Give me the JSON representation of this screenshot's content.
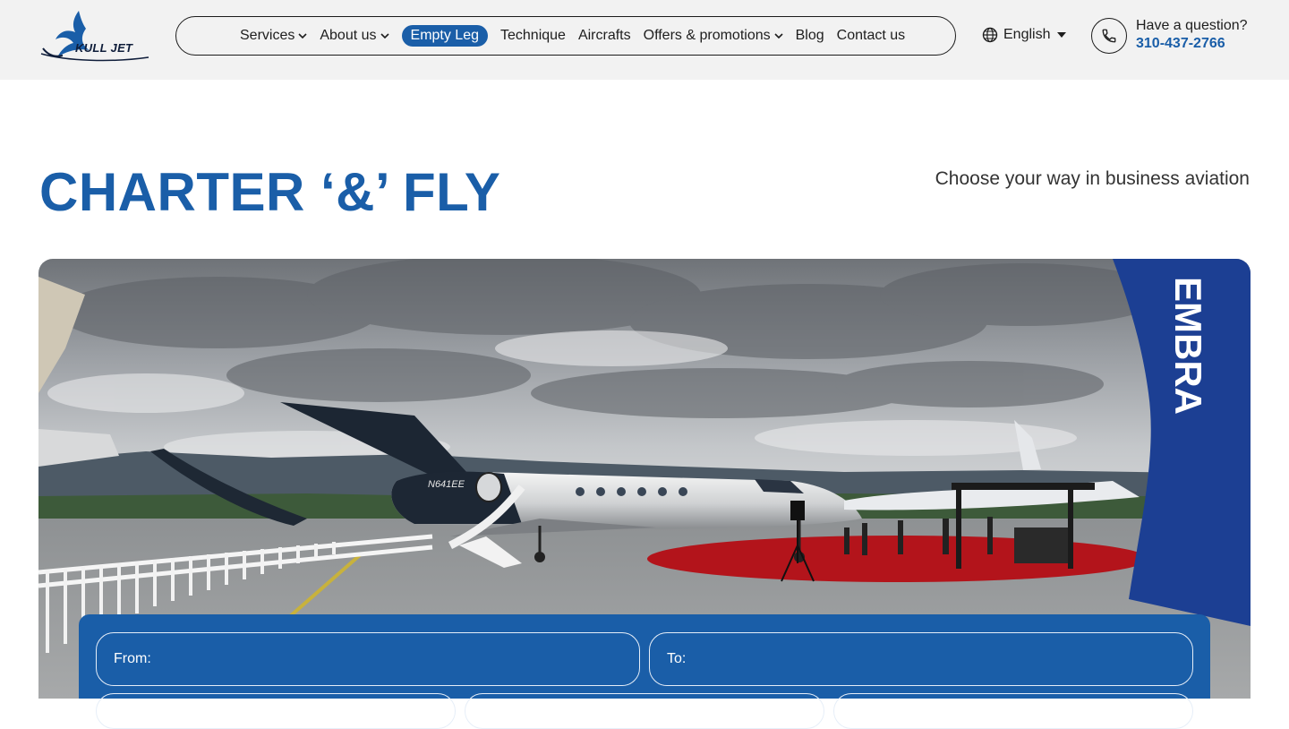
{
  "header": {
    "logo_text": "KULL JET",
    "nav": [
      {
        "label": "Services",
        "dropdown": true,
        "active": false
      },
      {
        "label": "About us",
        "dropdown": true,
        "active": false
      },
      {
        "label": "Empty Leg",
        "dropdown": false,
        "active": true
      },
      {
        "label": "Technique",
        "dropdown": false,
        "active": false
      },
      {
        "label": "Aircrafts",
        "dropdown": false,
        "active": false
      },
      {
        "label": "Offers & promotions",
        "dropdown": true,
        "active": false
      },
      {
        "label": "Blog",
        "dropdown": false,
        "active": false
      },
      {
        "label": "Contact us",
        "dropdown": false,
        "active": false
      }
    ],
    "language": "English",
    "question_label": "Have a question?",
    "phone": "310-437-2766"
  },
  "hero": {
    "title": "CHARTER ‘&’ FLY",
    "tagline": "Choose your way in business aviation"
  },
  "booking": {
    "from_placeholder": "From:",
    "to_placeholder": "To:"
  },
  "image": {
    "aircraft_registration": "N641EE",
    "banner_text": "EMBRA"
  },
  "colors": {
    "brand_blue": "#1a5ea8",
    "header_bg": "#f2f2f2"
  }
}
